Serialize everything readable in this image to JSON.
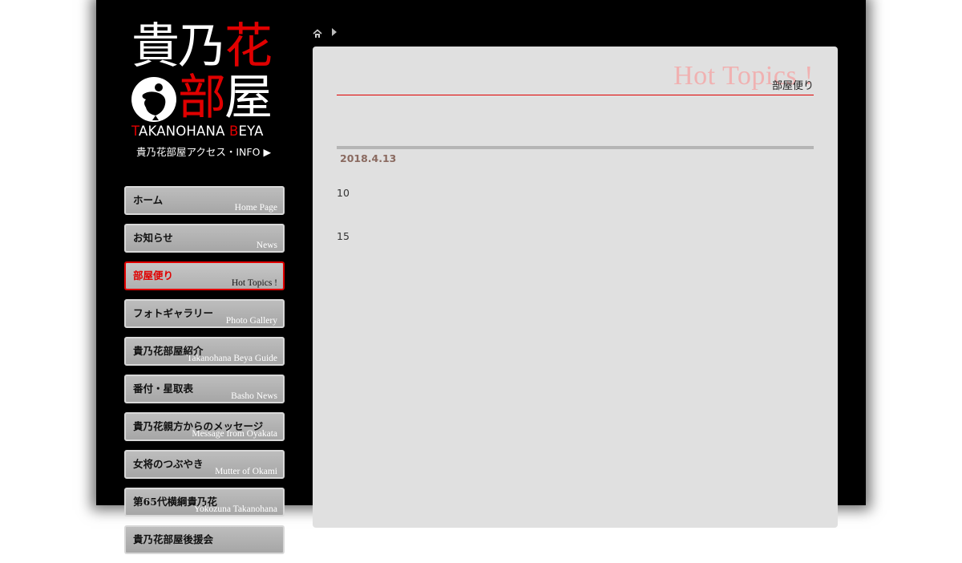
{
  "logo": {
    "line1_white": "貴乃",
    "line1_red": "花",
    "line2_red": "部",
    "line2_white": "屋",
    "roman": [
      "T",
      "AKANOHANA ",
      "B",
      "EYA"
    ],
    "access_label": "貴乃花部屋アクセス・INFO",
    "access_arrow": "▶"
  },
  "nav": [
    {
      "jp": "ホーム",
      "en": "Home Page"
    },
    {
      "jp": "お知らせ",
      "en": "News"
    },
    {
      "jp": "部屋便り",
      "en": "Hot Topics !"
    },
    {
      "jp": "フォトギャラリー",
      "en": "Photo Gallery"
    },
    {
      "jp": "貴乃花部屋紹介",
      "en": "Takanohana Beya Guide"
    },
    {
      "jp": "番付・星取表",
      "en": "Basho News"
    },
    {
      "jp": "貴乃花親方からのメッセージ",
      "en": "Message from Oyakata"
    },
    {
      "jp": "女将のつぶやき",
      "en": "Mutter of Okami"
    },
    {
      "jp": "第65代横綱貴乃花",
      "en": "Yokozuna Takanohana"
    },
    {
      "jp": "貴乃花部屋後援会",
      "en": ""
    }
  ],
  "nav_active_index": 2,
  "panel": {
    "heading_en": "Hot Topics !",
    "heading_jp": "部屋便り",
    "date": "2018.4.13",
    "lines": [
      "10",
      "15"
    ]
  },
  "colors": {
    "accent": "#e00000",
    "panel_bg": "#e0e0e0",
    "frame_bg": "#000000"
  }
}
